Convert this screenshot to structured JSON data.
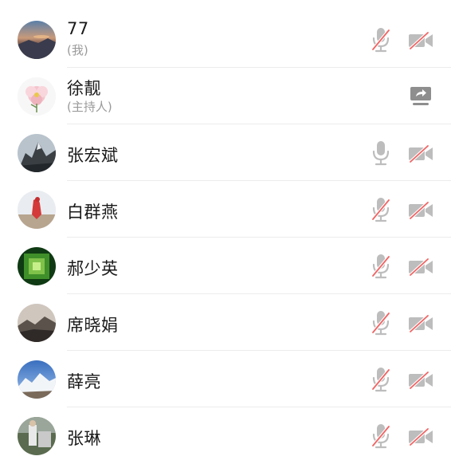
{
  "participants": [
    {
      "name": "77",
      "sub": "(我)",
      "avatar": "sunset-landscape",
      "mic": "muted",
      "camera": "off",
      "share": false
    },
    {
      "name": "徐靓",
      "sub": "(主持人)",
      "avatar": "pink-flower",
      "mic": "none",
      "camera": "none",
      "share": true
    },
    {
      "name": "张宏斌",
      "sub": "",
      "avatar": "mountain-peak",
      "mic": "on",
      "camera": "off",
      "share": false
    },
    {
      "name": "白群燕",
      "sub": "",
      "avatar": "red-figure",
      "mic": "muted",
      "camera": "off",
      "share": false
    },
    {
      "name": "郝少英",
      "sub": "",
      "avatar": "green-tunnel",
      "mic": "muted",
      "camera": "off",
      "share": false
    },
    {
      "name": "席晓娟",
      "sub": "",
      "avatar": "mountain-dusk",
      "mic": "muted",
      "camera": "off",
      "share": false
    },
    {
      "name": "薛亮",
      "sub": "",
      "avatar": "snowy-mountains",
      "mic": "muted",
      "camera": "off",
      "share": false
    },
    {
      "name": "张琳",
      "sub": "",
      "avatar": "person-outdoors",
      "mic": "muted",
      "camera": "off",
      "share": false
    }
  ],
  "colors": {
    "icon_gray": "#bdbdbd",
    "strike_red": "#f06464",
    "share_gray": "#8e8e8e",
    "text_primary": "#1a1a1a",
    "text_secondary": "#9a9a9a"
  }
}
